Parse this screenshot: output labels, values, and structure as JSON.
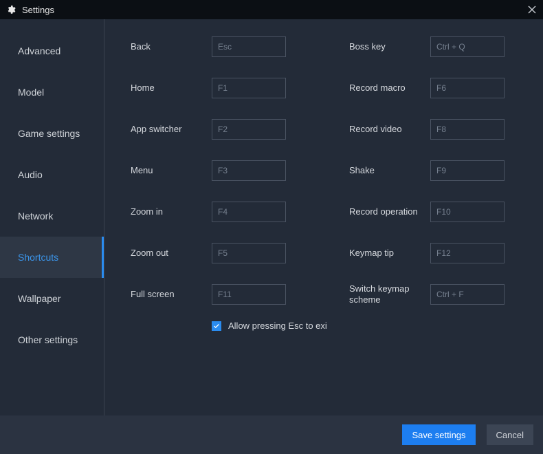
{
  "window": {
    "title": "Settings"
  },
  "sidebar": {
    "items": [
      {
        "label": "Advanced"
      },
      {
        "label": "Model"
      },
      {
        "label": "Game settings"
      },
      {
        "label": "Audio"
      },
      {
        "label": "Network"
      },
      {
        "label": "Shortcuts"
      },
      {
        "label": "Wallpaper"
      },
      {
        "label": "Other settings"
      }
    ],
    "active_index": 5
  },
  "shortcuts": {
    "left": [
      {
        "label": "Back",
        "placeholder": "Esc",
        "value": ""
      },
      {
        "label": "Home",
        "placeholder": "F1",
        "value": ""
      },
      {
        "label": "App switcher",
        "placeholder": "F2",
        "value": ""
      },
      {
        "label": "Menu",
        "placeholder": "F3",
        "value": ""
      },
      {
        "label": "Zoom in",
        "placeholder": "F4",
        "value": ""
      },
      {
        "label": "Zoom out",
        "placeholder": "F5",
        "value": ""
      },
      {
        "label": "Full screen",
        "placeholder": "F11",
        "value": ""
      }
    ],
    "right": [
      {
        "label": "Boss key",
        "placeholder": "Ctrl + Q",
        "value": ""
      },
      {
        "label": "Record macro",
        "placeholder": "F6",
        "value": ""
      },
      {
        "label": "Record video",
        "placeholder": "F8",
        "value": ""
      },
      {
        "label": "Shake",
        "placeholder": "F9",
        "value": ""
      },
      {
        "label": "Record operation",
        "placeholder": "F10",
        "value": ""
      },
      {
        "label": "Keymap tip",
        "placeholder": "F12",
        "value": ""
      },
      {
        "label": "Switch keymap scheme",
        "placeholder": "Ctrl + F",
        "value": ""
      }
    ],
    "allow_esc_checked": true,
    "allow_esc_label": "Allow pressing Esc to exi"
  },
  "footer": {
    "save_label": "Save settings",
    "cancel_label": "Cancel"
  }
}
